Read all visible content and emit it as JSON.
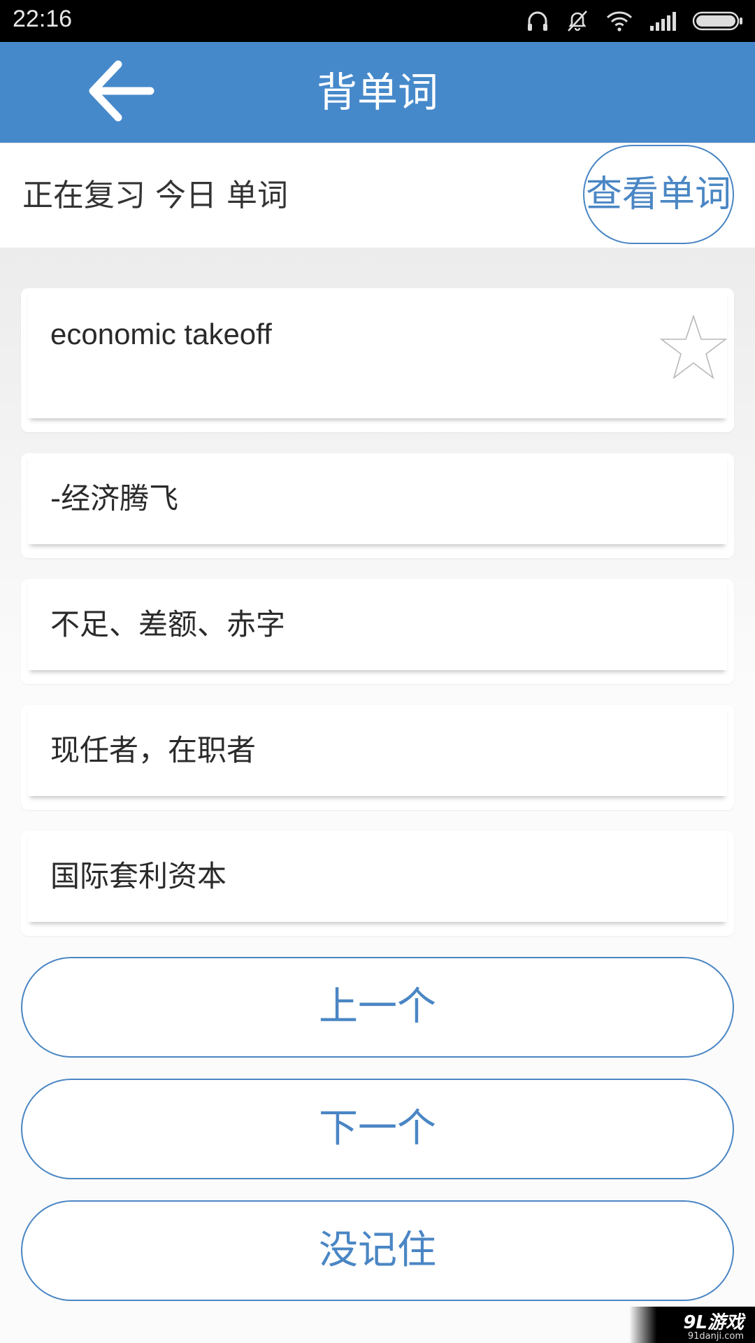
{
  "status_bar": {
    "time": "22:16",
    "icons": [
      "headset-icon",
      "mute-icon",
      "wifi-icon",
      "signal-icon",
      "battery-icon"
    ]
  },
  "app_bar": {
    "title": "背单词",
    "back_icon": "back-arrow-icon"
  },
  "header": {
    "reviewing_text": "正在复习 今日 单词",
    "view_words_label": "查看单词"
  },
  "word_card": {
    "word": "economic takeoff",
    "favorite_icon": "star-outline-icon"
  },
  "options": [
    {
      "label": "-经济腾飞"
    },
    {
      "label": "不足、差额、赤字"
    },
    {
      "label": "现任者，在职者"
    },
    {
      "label": "国际套利资本"
    }
  ],
  "actions": {
    "prev_label": "上一个",
    "next_label": "下一个",
    "forgot_label": "没记住"
  },
  "watermark": {
    "logo": "9L游戏",
    "url": "91danji.com"
  },
  "colors": {
    "app_bar": "#4689cb",
    "accent": "#4a86c4",
    "status_bar": "#000000",
    "text": "#2a2a2a"
  }
}
